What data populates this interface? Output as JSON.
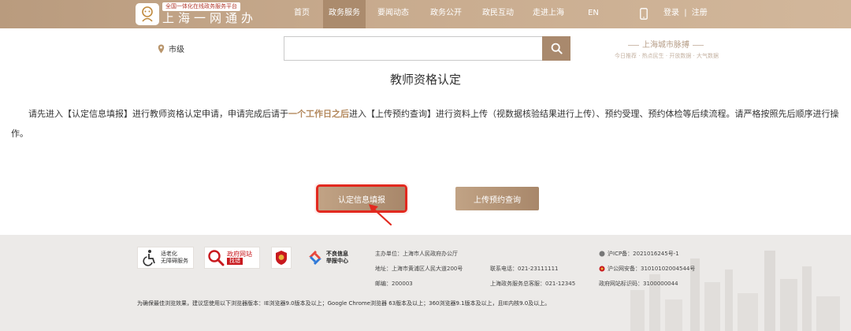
{
  "header": {
    "slogan": "全国一体化在线政务服务平台",
    "title": "上海一网通办",
    "nav": [
      "首页",
      "政务服务",
      "要闻动态",
      "政务公开",
      "政民互动",
      "走进上海",
      "EN"
    ],
    "active_nav": "政务服务",
    "login": "登录",
    "separator": "|",
    "register": "注册"
  },
  "search": {
    "location": "市级",
    "placeholder": ""
  },
  "promo": {
    "title": "上海城市脉搏",
    "subtitle": "今日推荐 · 热点民生 · 开放数据 · 大气数据"
  },
  "content": {
    "title": "教师资格认定",
    "desc_part1": "请先进入【认定信息填报】进行教师资格认定申请，申请完成后请于",
    "desc_highlight": "一个工作日之后",
    "desc_part2": "进入【上传预约查询】进行资料上传（视数据核验结果进行上传）、预约受理、预约体检等后续流程。请严格按照先后顺序进行操作。",
    "btn_fill": "认定信息填报",
    "btn_upload": "上传预约查询"
  },
  "footer": {
    "badge_elder_1": "适老化",
    "badge_elder_2": "无障碍服务",
    "badge_gov_1": "政府网站",
    "badge_gov_2": "找错",
    "badge_report_1": "不良信息",
    "badge_report_2": "举报中心",
    "sponsor": "主办单位：上海市人民政府办公厅",
    "address": "地址：上海市黄浦区人民大道200号",
    "postcode": "邮编：200003",
    "phone": "联系电话：021-23111111",
    "service_phone": "上海政务服务总客服：021-12345",
    "icp": "沪ICP备：2021016245号-1",
    "police": "沪公网安备：31010102004544号",
    "site_code": "政府网站标识码：3100000044",
    "browser_note": "为确保最佳浏览效果，建议您使用以下浏览器版本：IE浏览器9.0版本及以上；Google Chrome浏览器 63版本及以上；360浏览器9.1版本及以上，且IE内核9.0及以上。"
  },
  "colors": {
    "header_gold": "#c2a487",
    "accent_gold": "#b3885c",
    "button_gold": "#a8876a",
    "highlight_red": "#e2291f",
    "footer_bg": "#eceae8"
  }
}
